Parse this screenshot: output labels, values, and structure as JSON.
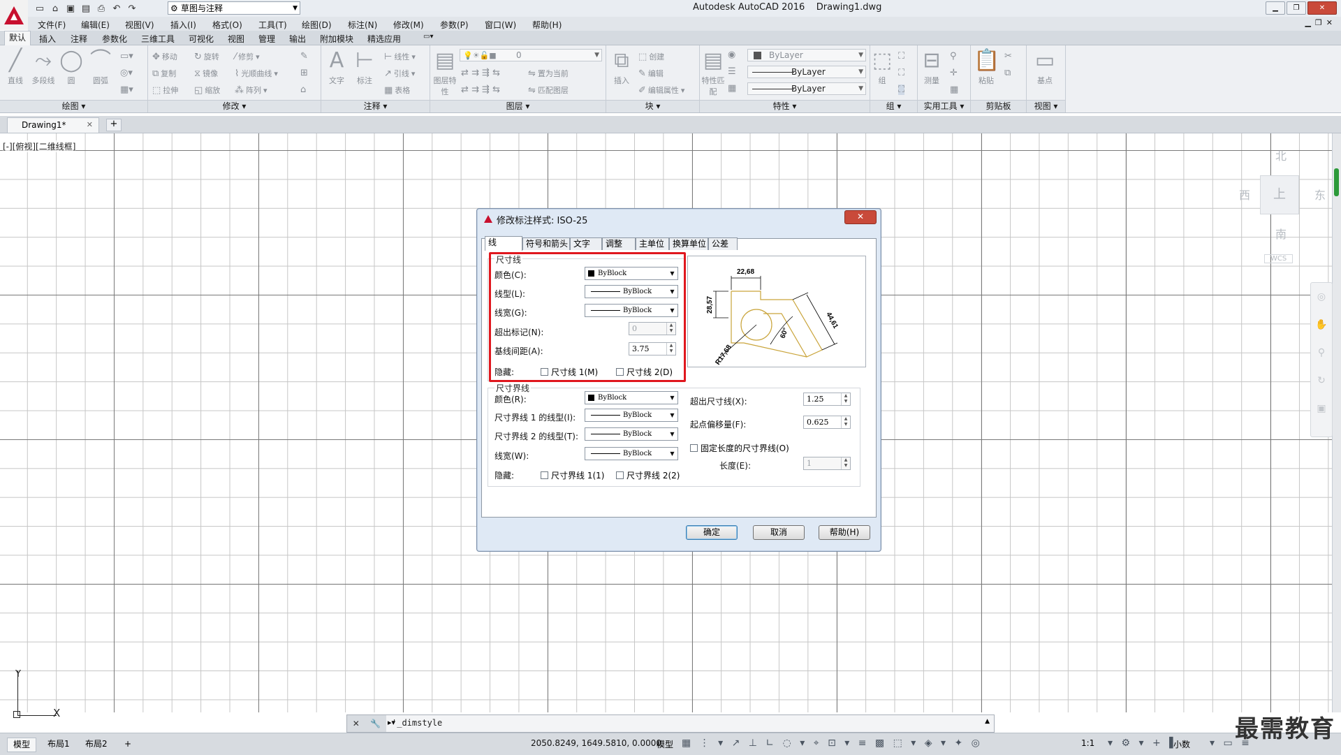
{
  "titlebar": {
    "workspace": "草图与注释",
    "app_title": "Autodesk AutoCAD 2016",
    "file_name": "Drawing1.dwg"
  },
  "menu": [
    "文件(F)",
    "编辑(E)",
    "视图(V)",
    "插入(I)",
    "格式(O)",
    "工具(T)",
    "绘图(D)",
    "标注(N)",
    "修改(M)",
    "参数(P)",
    "窗口(W)",
    "帮助(H)"
  ],
  "ribbon_tabs": [
    "默认",
    "插入",
    "注释",
    "参数化",
    "三维工具",
    "可视化",
    "视图",
    "管理",
    "输出",
    "附加模块",
    "精选应用"
  ],
  "ribbon": {
    "draw": {
      "title": "绘图",
      "tools": [
        "直线",
        "多段线",
        "圆",
        "圆弧"
      ]
    },
    "modify": {
      "title": "修改",
      "tools": [
        "移动",
        "旋转",
        "修剪",
        "复制",
        "镜像",
        "光顺曲线",
        "拉伸",
        "缩放",
        "阵列"
      ]
    },
    "annotation": {
      "title": "注释",
      "tools": [
        "文字",
        "标注",
        "线性",
        "引线",
        "表格"
      ]
    },
    "layers": {
      "title": "图层",
      "tools": [
        "图层特性",
        "置为当前",
        "匹配图层"
      ],
      "current_layer": "0"
    },
    "block": {
      "title": "块",
      "tools": [
        "插入",
        "创建",
        "编辑",
        "编辑属性"
      ]
    },
    "properties": {
      "title": "特性",
      "tools": [
        "特性匹配"
      ],
      "color": "ByLayer",
      "linetype": "ByLayer",
      "lineweight": "ByLayer"
    },
    "groups": {
      "title": "组",
      "tools": [
        "组"
      ]
    },
    "utilities": {
      "title": "实用工具",
      "tools": [
        "测量"
      ]
    },
    "clipboard": {
      "title": "剪贴板",
      "tools": [
        "粘贴"
      ]
    },
    "view": {
      "title": "视图",
      "tools": [
        "基点"
      ]
    }
  },
  "doc_tab": {
    "name": "Drawing1*"
  },
  "viewport_label": "[-][俯视][二维线框]",
  "viewcube": {
    "north": "北",
    "south": "南",
    "east": "东",
    "west": "西",
    "top": "上",
    "wcs": "WCS"
  },
  "ucs": {
    "x": "X",
    "y": "Y"
  },
  "command_line": {
    "text": "'_dimstyle"
  },
  "status": {
    "layouts": [
      "模型",
      "布局1",
      "布局2"
    ],
    "coords": "2050.8249, 1649.5810, 0.0000",
    "model": "模型",
    "scale": "1:1",
    "units": "小数"
  },
  "watermark": "最需教育",
  "dialog": {
    "title": "修改标注样式: ISO-25",
    "tabs": [
      "线",
      "符号和箭头",
      "文字",
      "调整",
      "主单位",
      "换算单位",
      "公差"
    ],
    "dim_lines": {
      "group": "尺寸线",
      "color_label": "颜色(C):",
      "color_value": "ByBlock",
      "linetype_label": "线型(L):",
      "linetype_value": "ByBlock",
      "lineweight_label": "线宽(G):",
      "lineweight_value": "ByBlock",
      "extend_label": "超出标记(N):",
      "extend_value": "0",
      "baseline_label": "基线间距(A):",
      "baseline_value": "3.75",
      "suppress_label": "隐藏:",
      "suppress1": "尺寸线 1(M)",
      "suppress2": "尺寸线 2(D)"
    },
    "ext_lines": {
      "group": "尺寸界线",
      "color_label": "颜色(R):",
      "color_value": "ByBlock",
      "linetype1_label": "尺寸界线 1 的线型(I):",
      "linetype1_value": "ByBlock",
      "linetype2_label": "尺寸界线 2 的线型(T):",
      "linetype2_value": "ByBlock",
      "lineweight_label": "线宽(W):",
      "lineweight_value": "ByBlock",
      "suppress_label": "隐藏:",
      "suppress1": "尺寸界线 1(1)",
      "suppress2": "尺寸界线 2(2)",
      "extend_label": "超出尺寸线(X):",
      "extend_value": "1.25",
      "offset_label": "起点偏移量(F):",
      "offset_value": "0.625",
      "fixed_label": "固定长度的尺寸界线(O)",
      "length_label": "长度(E):",
      "length_value": "1"
    },
    "preview_dims": {
      "top": "22,68",
      "left": "28,57",
      "right": "44,61",
      "angle": "60°",
      "radius": "R17,68"
    },
    "buttons": {
      "ok": "确定",
      "cancel": "取消",
      "help": "帮助(H)"
    }
  },
  "colors": {
    "accent_red": "#e0171e",
    "preview_geom": "#c9a43a"
  }
}
